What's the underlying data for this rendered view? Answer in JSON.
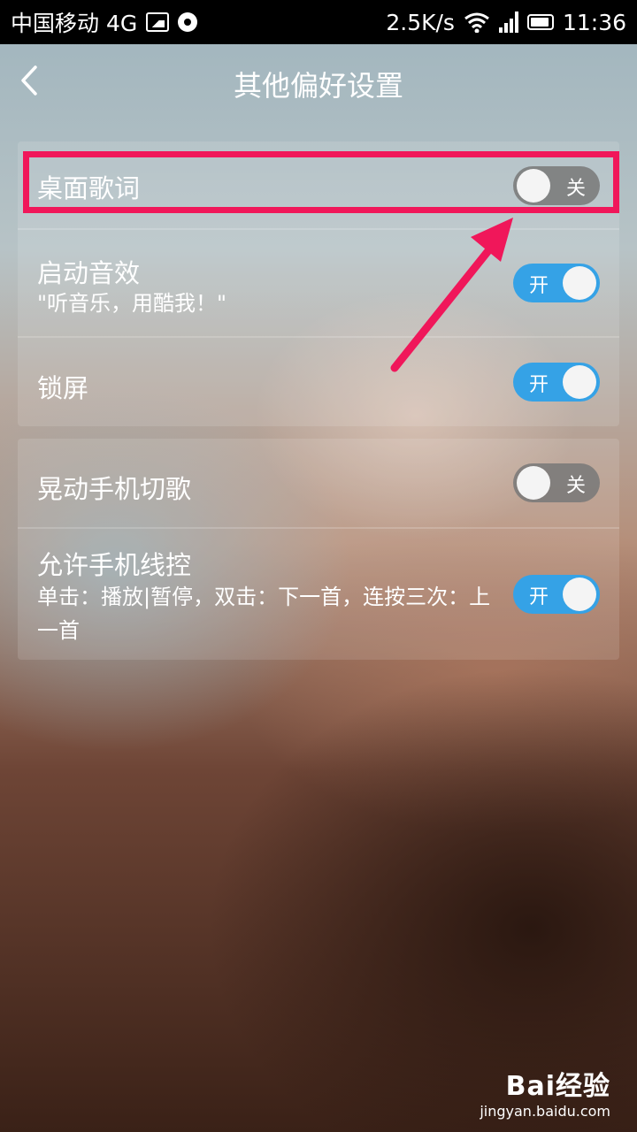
{
  "status_bar": {
    "carrier": "中国移动 4G",
    "speed": "2.5K/s",
    "time": "11:36",
    "icons": [
      "image-icon",
      "location-pin-icon",
      "wifi-icon",
      "signal-icon",
      "battery-icon"
    ]
  },
  "header": {
    "title": "其他偏好设置",
    "back_icon": "chevron-left-icon"
  },
  "settings": {
    "desktop_lyrics": {
      "label": "桌面歌词",
      "state": "关",
      "on": false
    },
    "startup_sound": {
      "label": "启动音效",
      "sub": "\"听音乐，用酷我！\"",
      "state": "开",
      "on": true
    },
    "lock_screen": {
      "label": "锁屏",
      "state": "开",
      "on": true
    },
    "shake_switch": {
      "label": "晃动手机切歌",
      "state": "关",
      "on": false
    },
    "wire_control": {
      "label": "允许手机线控",
      "sub": "单击：播放|暂停，双击：下一首，连按三次：上一首",
      "state": "开",
      "on": true
    }
  },
  "annotation": {
    "color": "#f0175a"
  },
  "colors": {
    "toggle_on": "#35a2e6",
    "toggle_off": "#7a7a7a"
  },
  "watermark": {
    "brand": "Bai经验",
    "url": "jingyan.baidu.com"
  }
}
